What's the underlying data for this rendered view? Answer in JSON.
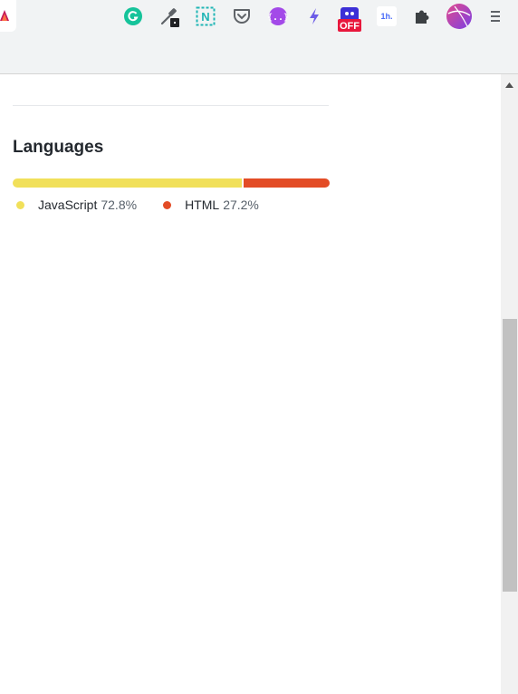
{
  "browser": {
    "extensions": [
      {
        "icon": "grammarly-icon",
        "color": "#15c39a"
      },
      {
        "icon": "eyedropper-icon",
        "color": "#5f6368"
      },
      {
        "icon": "notion-web-clipper-icon",
        "color": "#1fb5b5"
      },
      {
        "icon": "pocket-icon",
        "color": "#5f6368"
      },
      {
        "icon": "code-braces-icon",
        "color": "#a349e8"
      },
      {
        "icon": "lightning-icon",
        "color": "#6c5ce7"
      },
      {
        "icon": "off-badge-icon",
        "color": "#e8173c",
        "label": "OFF"
      },
      {
        "icon": "1h-icon",
        "color": "#4a6cf7",
        "label": "1h."
      },
      {
        "icon": "puzzle-icon",
        "color": "#3c4043"
      },
      {
        "icon": "profile-avatar-icon",
        "color": "#d04fa8"
      },
      {
        "icon": "menu-icon",
        "color": "#5f6368"
      }
    ]
  },
  "languages": {
    "heading": "Languages",
    "items": [
      {
        "name": "JavaScript",
        "percent_label": "72.8%",
        "percent": 72.8,
        "color": "#f1e05a"
      },
      {
        "name": "HTML",
        "percent_label": "27.2%",
        "percent": 27.2,
        "color": "#e34c26"
      }
    ]
  }
}
